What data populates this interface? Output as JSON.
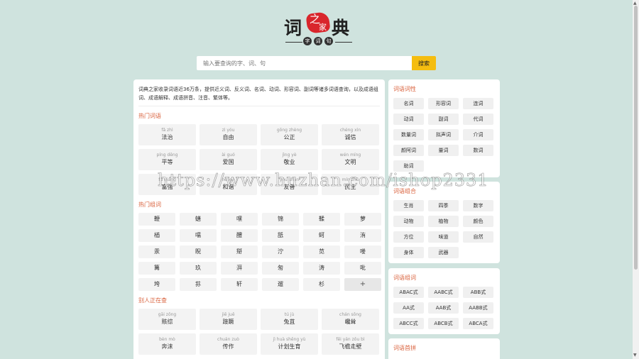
{
  "logo": {
    "left": "词",
    "stamp_top": "之",
    "stamp_bottom": "家",
    "right": "典",
    "sub": [
      "字",
      "词",
      "句"
    ]
  },
  "search": {
    "placeholder": "输入要查询的字、词、句",
    "button_label": "搜索"
  },
  "intro": "词典之家收录词语近36万条，提供近义词、反义词、名词、动词、形容词、副词等诸多词语查询，以及成语组词、成语解释、成语拼音、注音、繁体等。",
  "hot_words": {
    "title": "热门词语",
    "items": [
      {
        "py": "fǎ zhì",
        "zh": "法治"
      },
      {
        "py": "zì yóu",
        "zh": "自由"
      },
      {
        "py": "gōng zhèng",
        "zh": "公正"
      },
      {
        "py": "chéng xìn",
        "zh": "诚信"
      },
      {
        "py": "píng děng",
        "zh": "平等"
      },
      {
        "py": "ài guó",
        "zh": "爱国"
      },
      {
        "py": "jìng yè",
        "zh": "敬业"
      },
      {
        "py": "wén míng",
        "zh": "文明"
      },
      {
        "py": "fù qiáng",
        "zh": "富强"
      },
      {
        "py": "hé xié",
        "zh": "和谐"
      },
      {
        "py": "yǒu shàn",
        "zh": "友善"
      },
      {
        "py": "mín zhǔ",
        "zh": "民主"
      }
    ]
  },
  "hot_chars": {
    "title": "热门组词",
    "items": [
      "鞭",
      "蟮",
      "嘿",
      "锦",
      "鞣",
      "萝",
      "楢",
      "嚅",
      "醴",
      "舐",
      "蚵",
      "洧",
      "汞",
      "睨",
      "搿",
      "泞",
      "苋",
      "喽",
      "篝",
      "玖",
      "湃",
      "匆",
      "涛",
      "吡",
      "垮",
      "荪",
      "轩",
      "遛",
      "杉"
    ],
    "more_label": "+"
  },
  "recent": {
    "title": "别人正在查",
    "items": [
      {
        "py": "gāi zōng",
        "zh": "赅综"
      },
      {
        "py": "jiē juě",
        "zh": "踥蹶"
      },
      {
        "py": "tú jù",
        "zh": "兔苴"
      },
      {
        "py": "chán sǒng",
        "zh": "巉耸"
      },
      {
        "py": "bèn mò",
        "zh": "奔沫"
      },
      {
        "py": "chuán zuò",
        "zh": "传作"
      },
      {
        "py": "jì huà shēng yù",
        "zh": "计划生育"
      },
      {
        "py": "fēi yán zǒu bì",
        "zh": "飞檐走壁"
      }
    ]
  },
  "cixing": {
    "title": "词语词性",
    "tags": [
      "名词",
      "形容词",
      "连词",
      "动词",
      "副词",
      "代词",
      "数量词",
      "拟声词",
      "介词",
      "颜阿词",
      "量词",
      "数词",
      "助词"
    ]
  },
  "zuhe": {
    "title": "词语组合",
    "tags": [
      "生肖",
      "四季",
      "数字",
      "动物",
      "植物",
      "颜色",
      "方位",
      "味道",
      "自然",
      "身体",
      "武器"
    ]
  },
  "zuci": {
    "title": "词语组词",
    "tags": [
      "ABAC式",
      "AABC式",
      "ABB式",
      "AA式",
      "AAB式",
      "AABB式",
      "ABCC式",
      "ABCB式",
      "ABCA式"
    ]
  },
  "shoupin": {
    "title": "词语首拼"
  },
  "watermark": "https://www.huzhan.com/ishop2331"
}
